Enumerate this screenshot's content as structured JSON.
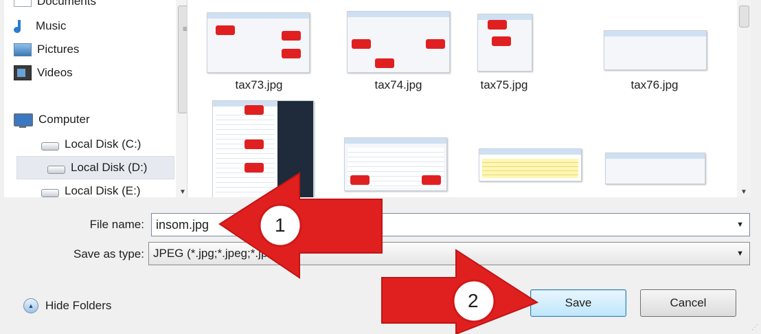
{
  "sidebar": {
    "items": [
      {
        "label": "Documents",
        "icon": "documents-icon"
      },
      {
        "label": "Music",
        "icon": "music-icon"
      },
      {
        "label": "Pictures",
        "icon": "pictures-icon"
      },
      {
        "label": "Videos",
        "icon": "videos-icon"
      },
      {
        "label": "Computer",
        "icon": "computer-icon"
      },
      {
        "label": "Local Disk (C:)",
        "icon": "disk-icon"
      },
      {
        "label": "Local Disk (D:)",
        "icon": "disk-icon",
        "selected": true
      },
      {
        "label": "Local Disk (E:)",
        "icon": "disk-icon"
      }
    ]
  },
  "files": {
    "items": [
      {
        "label": "tax73.jpg"
      },
      {
        "label": "tax74.jpg"
      },
      {
        "label": "tax75.jpg"
      },
      {
        "label": "tax76.jpg"
      }
    ]
  },
  "form": {
    "file_name_label": "File name:",
    "file_name_value": "insom.jpg",
    "save_type_label": "Save as type:",
    "save_type_value": "JPEG (*.jpg;*.jpeg;*.jpe;*.jfif)"
  },
  "footer": {
    "hide_folders": "Hide Folders",
    "save": "Save",
    "cancel": "Cancel"
  },
  "annotations": {
    "step1": "1",
    "step2": "2",
    "arrow_color": "#e0201f"
  }
}
